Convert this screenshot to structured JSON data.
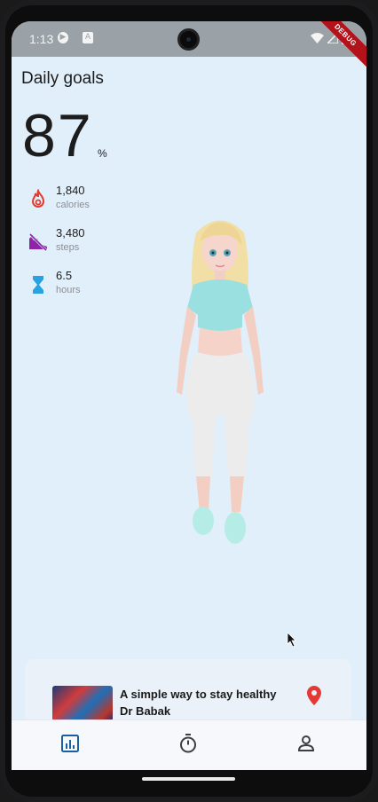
{
  "status_bar": {
    "time": "1:13",
    "icons_left": [
      "shield-play-icon",
      "a-badge-icon"
    ],
    "icons_right": [
      "wifi-icon",
      "signal-icon",
      "battery-icon"
    ],
    "debug_label": "DEBUG"
  },
  "header": {
    "title": "Daily goals",
    "progress_value": "87",
    "progress_unit": "%"
  },
  "stats": [
    {
      "icon": "flame-icon",
      "value": "1,840",
      "label": "calories",
      "color": "#e23a2c"
    },
    {
      "icon": "steps-icon",
      "value": "3,480",
      "label": "steps",
      "color": "#8e24aa"
    },
    {
      "icon": "hourglass-icon",
      "value": "6.5",
      "label": "hours",
      "color": "#29a3e0"
    }
  ],
  "article": {
    "title": "A simple way to stay healthy",
    "author": "Dr Babak",
    "pin_color": "#e53935"
  },
  "bottom_nav": {
    "items": [
      {
        "icon": "chart-icon",
        "active": true
      },
      {
        "icon": "timer-icon",
        "active": false
      },
      {
        "icon": "profile-icon",
        "active": false
      }
    ],
    "active_color": "#1a5fa0"
  }
}
